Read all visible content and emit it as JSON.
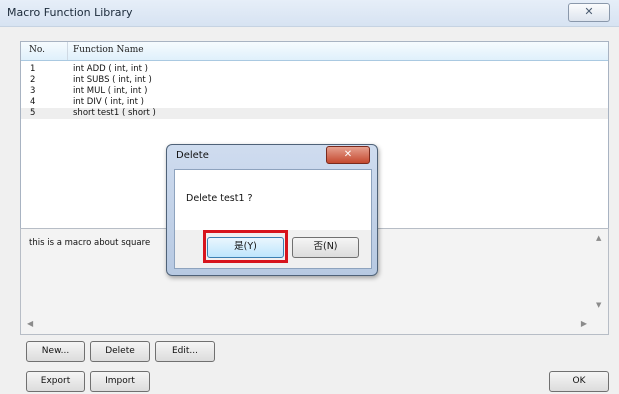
{
  "window": {
    "title": "Macro Function Library",
    "close_glyph": "✕"
  },
  "table": {
    "columns": [
      "No.",
      "Function Name"
    ],
    "rows": [
      {
        "no": "1",
        "name": "int ADD ( int, int )"
      },
      {
        "no": "2",
        "name": "int SUBS ( int, int )"
      },
      {
        "no": "3",
        "name": "int MUL ( int, int )"
      },
      {
        "no": "4",
        "name": "int DIV ( int, int )"
      },
      {
        "no": "5",
        "name": "short test1 ( short )"
      }
    ]
  },
  "description": {
    "text": "this is a macro about square"
  },
  "scrollbars": {
    "up": "▲",
    "down": "▼",
    "left": "◀",
    "right": "▶"
  },
  "buttons": {
    "new": "New...",
    "delete": "Delete",
    "edit": "Edit...",
    "export": "Export",
    "import": "Import",
    "ok": "OK"
  },
  "dialog": {
    "title": "Delete",
    "close_glyph": "✕",
    "message": "Delete test1 ?",
    "yes_label": "是(Y)",
    "no_label": "否(N)"
  },
  "colors": {
    "highlight": "#d7141c",
    "header_bg": "#dff0fb"
  }
}
